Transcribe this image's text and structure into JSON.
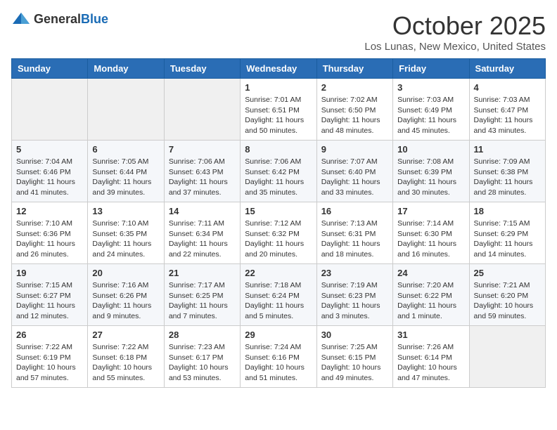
{
  "logo": {
    "text_general": "General",
    "text_blue": "Blue"
  },
  "title": {
    "month": "October 2025",
    "location": "Los Lunas, New Mexico, United States"
  },
  "headers": [
    "Sunday",
    "Monday",
    "Tuesday",
    "Wednesday",
    "Thursday",
    "Friday",
    "Saturday"
  ],
  "weeks": [
    [
      {
        "day": "",
        "info": ""
      },
      {
        "day": "",
        "info": ""
      },
      {
        "day": "",
        "info": ""
      },
      {
        "day": "1",
        "info": "Sunrise: 7:01 AM\nSunset: 6:51 PM\nDaylight: 11 hours\nand 50 minutes."
      },
      {
        "day": "2",
        "info": "Sunrise: 7:02 AM\nSunset: 6:50 PM\nDaylight: 11 hours\nand 48 minutes."
      },
      {
        "day": "3",
        "info": "Sunrise: 7:03 AM\nSunset: 6:49 PM\nDaylight: 11 hours\nand 45 minutes."
      },
      {
        "day": "4",
        "info": "Sunrise: 7:03 AM\nSunset: 6:47 PM\nDaylight: 11 hours\nand 43 minutes."
      }
    ],
    [
      {
        "day": "5",
        "info": "Sunrise: 7:04 AM\nSunset: 6:46 PM\nDaylight: 11 hours\nand 41 minutes."
      },
      {
        "day": "6",
        "info": "Sunrise: 7:05 AM\nSunset: 6:44 PM\nDaylight: 11 hours\nand 39 minutes."
      },
      {
        "day": "7",
        "info": "Sunrise: 7:06 AM\nSunset: 6:43 PM\nDaylight: 11 hours\nand 37 minutes."
      },
      {
        "day": "8",
        "info": "Sunrise: 7:06 AM\nSunset: 6:42 PM\nDaylight: 11 hours\nand 35 minutes."
      },
      {
        "day": "9",
        "info": "Sunrise: 7:07 AM\nSunset: 6:40 PM\nDaylight: 11 hours\nand 33 minutes."
      },
      {
        "day": "10",
        "info": "Sunrise: 7:08 AM\nSunset: 6:39 PM\nDaylight: 11 hours\nand 30 minutes."
      },
      {
        "day": "11",
        "info": "Sunrise: 7:09 AM\nSunset: 6:38 PM\nDaylight: 11 hours\nand 28 minutes."
      }
    ],
    [
      {
        "day": "12",
        "info": "Sunrise: 7:10 AM\nSunset: 6:36 PM\nDaylight: 11 hours\nand 26 minutes."
      },
      {
        "day": "13",
        "info": "Sunrise: 7:10 AM\nSunset: 6:35 PM\nDaylight: 11 hours\nand 24 minutes."
      },
      {
        "day": "14",
        "info": "Sunrise: 7:11 AM\nSunset: 6:34 PM\nDaylight: 11 hours\nand 22 minutes."
      },
      {
        "day": "15",
        "info": "Sunrise: 7:12 AM\nSunset: 6:32 PM\nDaylight: 11 hours\nand 20 minutes."
      },
      {
        "day": "16",
        "info": "Sunrise: 7:13 AM\nSunset: 6:31 PM\nDaylight: 11 hours\nand 18 minutes."
      },
      {
        "day": "17",
        "info": "Sunrise: 7:14 AM\nSunset: 6:30 PM\nDaylight: 11 hours\nand 16 minutes."
      },
      {
        "day": "18",
        "info": "Sunrise: 7:15 AM\nSunset: 6:29 PM\nDaylight: 11 hours\nand 14 minutes."
      }
    ],
    [
      {
        "day": "19",
        "info": "Sunrise: 7:15 AM\nSunset: 6:27 PM\nDaylight: 11 hours\nand 12 minutes."
      },
      {
        "day": "20",
        "info": "Sunrise: 7:16 AM\nSunset: 6:26 PM\nDaylight: 11 hours\nand 9 minutes."
      },
      {
        "day": "21",
        "info": "Sunrise: 7:17 AM\nSunset: 6:25 PM\nDaylight: 11 hours\nand 7 minutes."
      },
      {
        "day": "22",
        "info": "Sunrise: 7:18 AM\nSunset: 6:24 PM\nDaylight: 11 hours\nand 5 minutes."
      },
      {
        "day": "23",
        "info": "Sunrise: 7:19 AM\nSunset: 6:23 PM\nDaylight: 11 hours\nand 3 minutes."
      },
      {
        "day": "24",
        "info": "Sunrise: 7:20 AM\nSunset: 6:22 PM\nDaylight: 11 hours\nand 1 minute."
      },
      {
        "day": "25",
        "info": "Sunrise: 7:21 AM\nSunset: 6:20 PM\nDaylight: 10 hours\nand 59 minutes."
      }
    ],
    [
      {
        "day": "26",
        "info": "Sunrise: 7:22 AM\nSunset: 6:19 PM\nDaylight: 10 hours\nand 57 minutes."
      },
      {
        "day": "27",
        "info": "Sunrise: 7:22 AM\nSunset: 6:18 PM\nDaylight: 10 hours\nand 55 minutes."
      },
      {
        "day": "28",
        "info": "Sunrise: 7:23 AM\nSunset: 6:17 PM\nDaylight: 10 hours\nand 53 minutes."
      },
      {
        "day": "29",
        "info": "Sunrise: 7:24 AM\nSunset: 6:16 PM\nDaylight: 10 hours\nand 51 minutes."
      },
      {
        "day": "30",
        "info": "Sunrise: 7:25 AM\nSunset: 6:15 PM\nDaylight: 10 hours\nand 49 minutes."
      },
      {
        "day": "31",
        "info": "Sunrise: 7:26 AM\nSunset: 6:14 PM\nDaylight: 10 hours\nand 47 minutes."
      },
      {
        "day": "",
        "info": ""
      }
    ]
  ]
}
